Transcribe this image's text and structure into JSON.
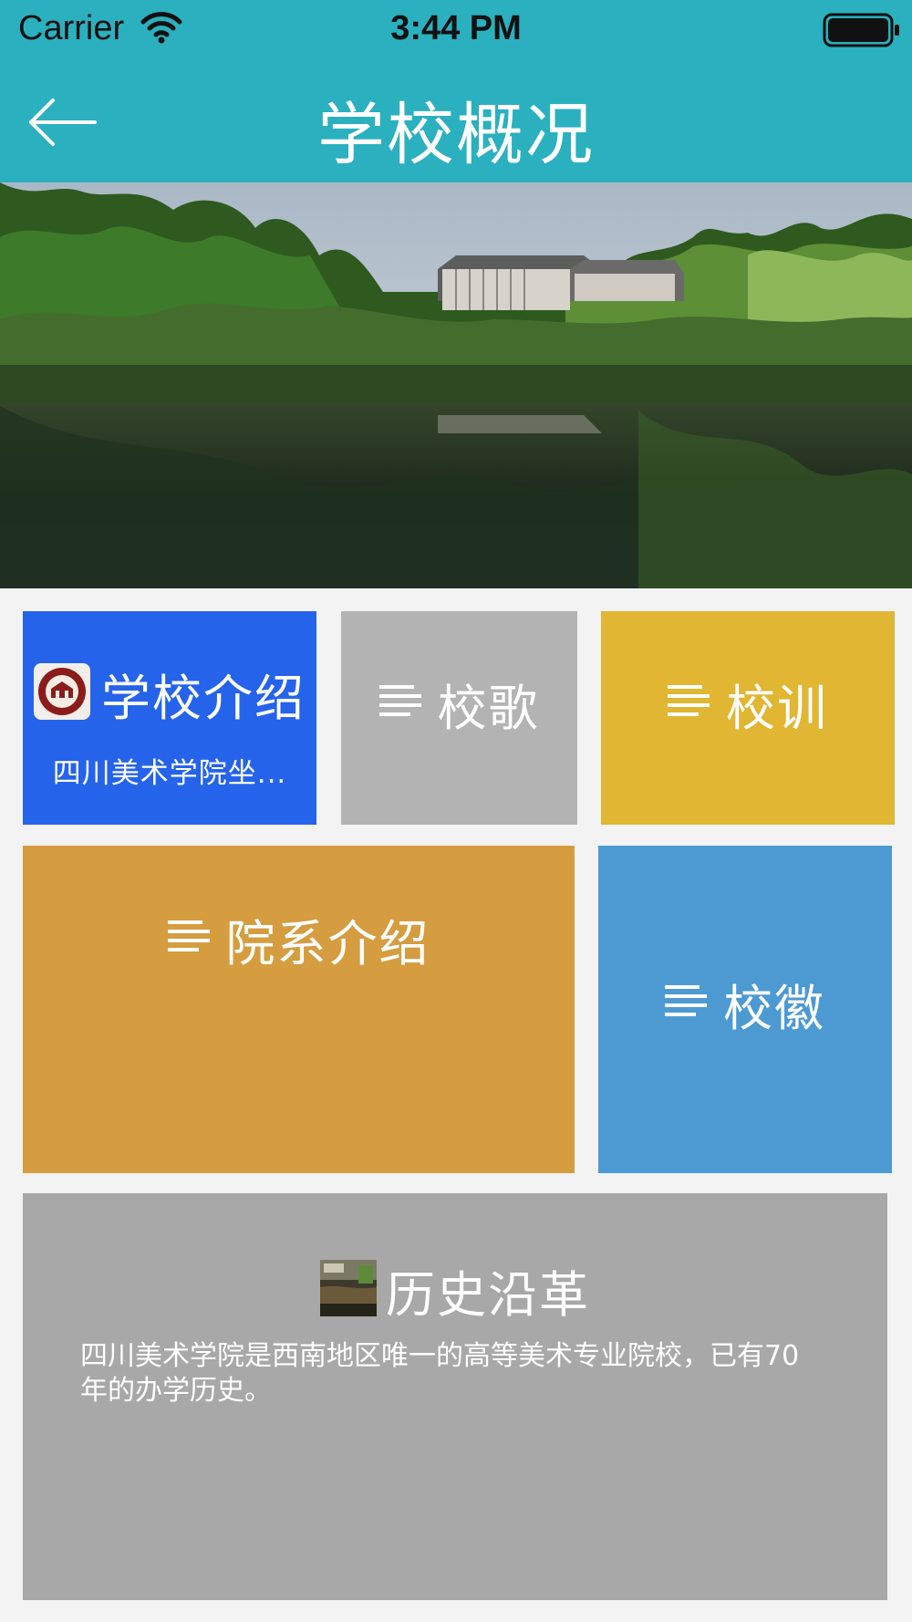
{
  "status_bar": {
    "carrier": "Carrier",
    "time": "3:44 PM"
  },
  "nav": {
    "title": "学校概况",
    "back_icon": "arrow-left-icon"
  },
  "hero": {
    "image": "campus-lake-photo"
  },
  "tiles": {
    "school_intro": {
      "label": "学校介绍",
      "subtitle": "四川美术学院坐...",
      "icon": "school-logo-icon",
      "color": "#2563eb"
    },
    "school_song": {
      "label": "校歌",
      "icon": "menu-lines-icon",
      "color": "#b3b3b3"
    },
    "school_motto": {
      "label": "校训",
      "icon": "menu-lines-icon",
      "color": "#e0b632"
    },
    "departments": {
      "label": "院系介绍",
      "icon": "menu-lines-icon",
      "color": "#d59d40"
    },
    "school_emblem": {
      "label": "校徽",
      "icon": "menu-lines-icon",
      "color": "#4d9ad2"
    },
    "history": {
      "label": "历史沿革",
      "icon": "history-thumbnail-icon",
      "description": "四川美术学院是西南地区唯一的高等美术专业院校，已有70年的办学历史。",
      "color": "#a8a8a8"
    }
  },
  "colors": {
    "header": "#2bb0bf",
    "background": "#f3f3f3"
  }
}
